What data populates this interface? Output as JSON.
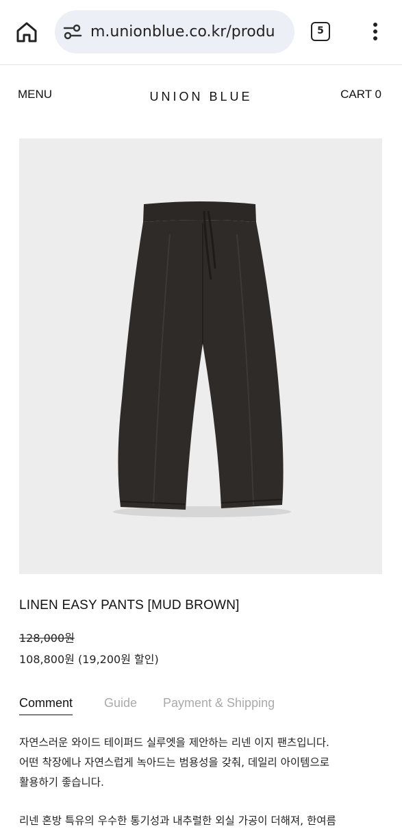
{
  "browser": {
    "url": "m.unionblue.co.kr/produ",
    "tab_count": "5",
    "icons": [
      "home-icon",
      "site-settings-icon",
      "tab-switcher-icon",
      "more-options-icon"
    ]
  },
  "header": {
    "menu_label": "MENU",
    "logo": "UNION BLUE",
    "cart_label": "CART 0"
  },
  "product": {
    "name": "LINEN EASY PANTS [MUD BROWN]",
    "original_price": "128,000원",
    "sale_price": "108,800원 (19,200원 할인)",
    "image_colors": {
      "background": "#ededed",
      "garment": "#2e2b28"
    }
  },
  "tabs": [
    {
      "label": "Comment",
      "active": true
    },
    {
      "label": "Guide",
      "active": false
    },
    {
      "label": "Payment & Shipping",
      "active": false
    }
  ],
  "description": {
    "line1": "자연스러운 와이드 테이퍼드 실루엣을 제안하는 리넨 이지 팬츠입니다.",
    "line2": "어떤 착장에나 자연스럽게 녹아드는 범용성을 갖춰, 데일리 아이템으로",
    "line3": "활용하기 좋습니다.",
    "line4": "리넨 혼방 특유의 우수한 통기성과 내추럴한 외실 가공이 더해져, 한여름"
  }
}
